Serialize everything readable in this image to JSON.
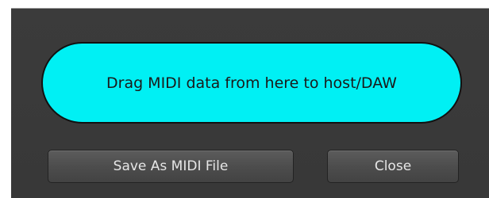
{
  "drag_area": {
    "label": "Drag MIDI data from here to host/DAW"
  },
  "buttons": {
    "save_label": "Save As MIDI File",
    "close_label": "Close"
  },
  "colors": {
    "panel_background": "#3a3a3a",
    "drag_area_fill": "#00f0f4",
    "button_text": "#e6e6e6"
  }
}
